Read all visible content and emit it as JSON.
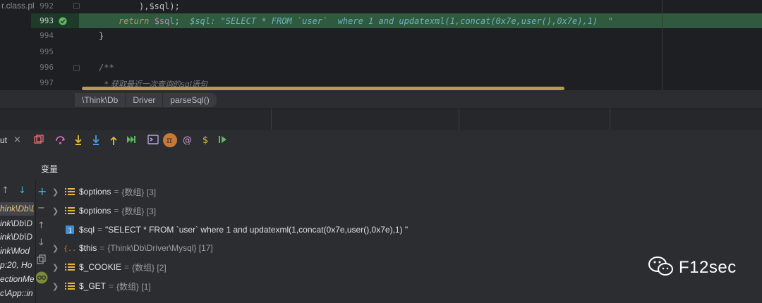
{
  "editor": {
    "file_fragment": "r.class.pl",
    "lines": [
      {
        "number": "992",
        "text": "),$sql);"
      },
      {
        "number": "993",
        "kw": "return",
        "var": "$sql",
        "rest": ";",
        "debug": "$sql: \"SELECT * FROM `user`  where 1 and updatexml(1,concat(0x7e,user(),0x7e),1)  \""
      },
      {
        "number": "994",
        "text": "}"
      },
      {
        "number": "995",
        "text": ""
      },
      {
        "number": "996",
        "text": "/**"
      },
      {
        "number": "997",
        "text": "* 获取最近一次查询的sql语句"
      }
    ]
  },
  "breadcrumb": [
    "\\Think\\Db",
    "Driver",
    "parseSql()"
  ],
  "debugger": {
    "tab_label": "ut",
    "tab_close": "×",
    "variables_title": "变量",
    "frames": [
      "hink\\Db\\D",
      "ink\\Db\\D",
      "ink\\Db\\D",
      "ink\\Mod",
      "p:20, Ho",
      "ectionMe",
      "c\\App::in"
    ],
    "variables": [
      {
        "name": "$options",
        "value": "{数组} [3]",
        "icon": "array-icon"
      },
      {
        "name": "$options",
        "value": "{数组} [3]",
        "icon": "array-icon"
      },
      {
        "name": "$sql",
        "value": "\"SELECT * FROM `user`  where 1 and updatexml(1,concat(0x7e,user(),0x7e),1)  \"",
        "icon": "string-icon"
      },
      {
        "name": "$this",
        "value": "{Think\\Db\\Driver\\Mysql} [17]",
        "icon": "object-icon"
      },
      {
        "name": "$_COOKIE",
        "value": "{数组} [2]",
        "icon": "array-icon"
      },
      {
        "name": "$_GET",
        "value": "{数组} [1]",
        "icon": "array-icon"
      }
    ]
  },
  "watermark": {
    "text": "F12sec"
  },
  "colors": {
    "highlight_line": "#2f5a3e",
    "breakpoint_check": "#5fb85f",
    "scrollbar": "#b59b52"
  }
}
